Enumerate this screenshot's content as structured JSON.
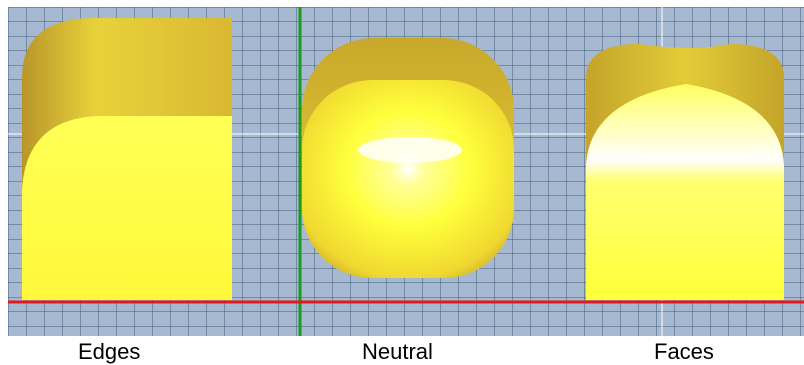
{
  "labels": {
    "edges": "Edges",
    "neutral": "Neutral",
    "faces": "Faces"
  },
  "colors": {
    "grid_background": "#a7b9d1",
    "grid_line": "#3f5a7a",
    "axis_x": "#e01a1a",
    "axis_y": "#1a9a1a",
    "guide_line": "#ffffff",
    "shape_bright": "#ffff44",
    "shape_mid": "#f2e63c",
    "shape_dark": "#c7a82a",
    "highlight": "#ffffff"
  }
}
